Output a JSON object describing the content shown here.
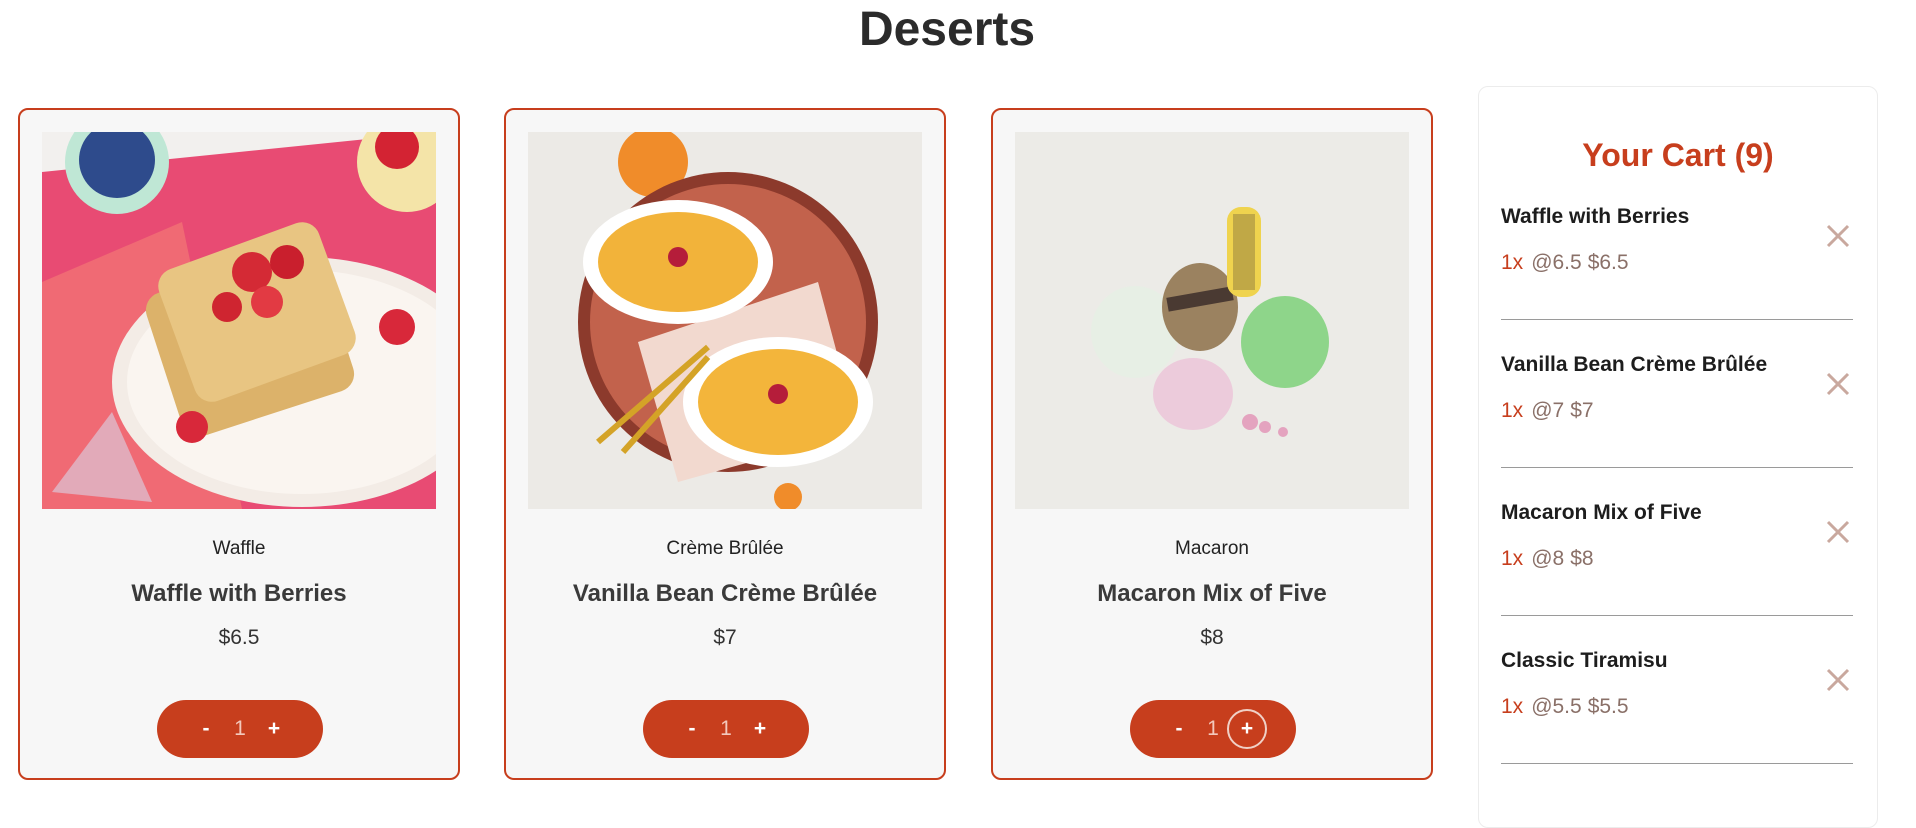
{
  "page": {
    "title": "Deserts"
  },
  "products": [
    {
      "category": "Waffle",
      "name": "Waffle with Berries",
      "price": "$6.5",
      "quantity": "1",
      "minus": "-",
      "plus": "+"
    },
    {
      "category": "Crème Brûlée",
      "name": "Vanilla Bean Crème Brûlée",
      "price": "$7",
      "quantity": "1",
      "minus": "-",
      "plus": "+"
    },
    {
      "category": "Macaron",
      "name": "Macaron Mix of Five",
      "price": "$8",
      "quantity": "1",
      "minus": "-",
      "plus": "+"
    }
  ],
  "cart": {
    "title": "Your Cart (9)",
    "items": [
      {
        "name": "Waffle with Berries",
        "qty": "1x",
        "unit": "@6.5",
        "total": "$6.5"
      },
      {
        "name": "Vanilla Bean Crème Brûlée",
        "qty": "1x",
        "unit": "@7",
        "total": "$7"
      },
      {
        "name": "Macaron Mix of Five",
        "qty": "1x",
        "unit": "@8",
        "total": "$8"
      },
      {
        "name": "Classic Tiramisu",
        "qty": "1x",
        "unit": "@5.5",
        "total": "$5.5"
      }
    ]
  },
  "colors": {
    "accent": "#c73e1d",
    "card_bg": "#f7f7f7",
    "remove_icon": "#c9a89e"
  },
  "icons": {
    "remove": "close-icon",
    "images": [
      "waffle-image",
      "creme-brulee-image",
      "macaron-image"
    ]
  }
}
